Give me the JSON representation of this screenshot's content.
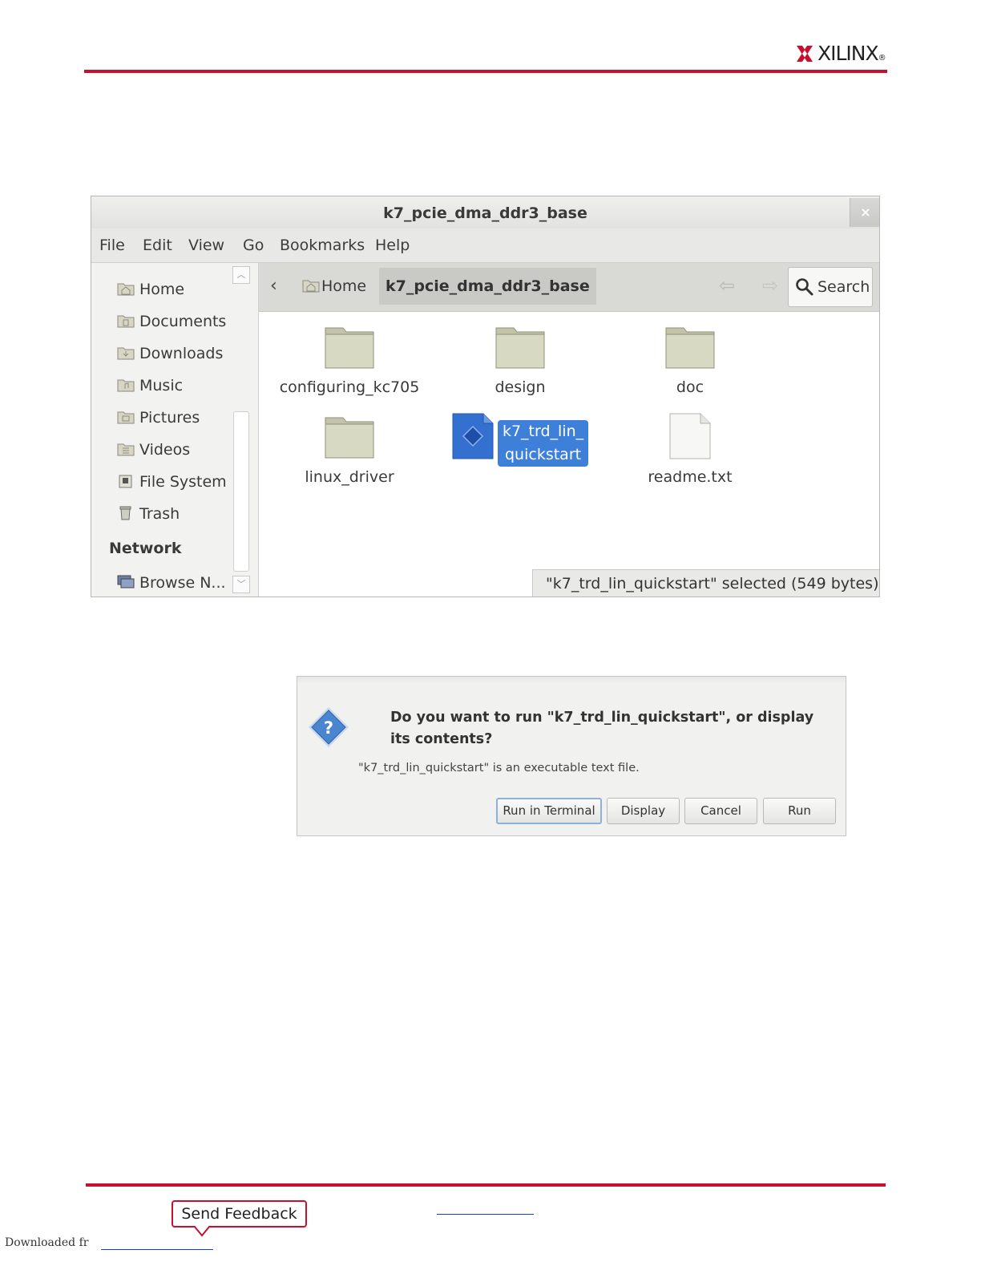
{
  "brand": {
    "name": "XILINX",
    "registered": "®",
    "accent_color": "#c8102e"
  },
  "file_manager": {
    "title": "k7_pcie_dma_ddr3_base",
    "close_glyph": "×",
    "menu": [
      "File",
      "Edit",
      "View",
      "Go",
      "Bookmarks",
      "Help"
    ],
    "sidebar": {
      "places": [
        {
          "label": "Home",
          "icon": "home-folder-icon"
        },
        {
          "label": "Documents",
          "icon": "documents-folder-icon"
        },
        {
          "label": "Downloads",
          "icon": "downloads-folder-icon"
        },
        {
          "label": "Music",
          "icon": "music-folder-icon"
        },
        {
          "label": "Pictures",
          "icon": "pictures-folder-icon"
        },
        {
          "label": "Videos",
          "icon": "videos-folder-icon"
        },
        {
          "label": "File System",
          "icon": "drive-icon"
        },
        {
          "label": "Trash",
          "icon": "trash-icon"
        }
      ],
      "network_heading": "Network",
      "network_items": [
        {
          "label": "Browse N...",
          "icon": "network-computer-icon"
        }
      ]
    },
    "toolbar": {
      "back_glyph": "‹",
      "home_crumb": "Home",
      "current_crumb": "k7_pcie_dma_ddr3_base",
      "search_label": "Search"
    },
    "files": [
      {
        "name": "configuring_kc705",
        "kind": "folder"
      },
      {
        "name": "design",
        "kind": "folder"
      },
      {
        "name": "doc",
        "kind": "folder"
      },
      {
        "name": "linux_driver",
        "kind": "folder"
      },
      {
        "name_line1": "k7_trd_lin_",
        "name_line2": "quickstart",
        "kind": "executable",
        "selected": true
      },
      {
        "name": "readme.txt",
        "kind": "text"
      }
    ],
    "status": "\"k7_trd_lin_quickstart\" selected (549 bytes)",
    "selection_color": "#3d7fd9"
  },
  "dialog": {
    "question": "Do you want to run \"k7_trd_lin_quickstart\", or display its contents?",
    "detail": "\"k7_trd_lin_quickstart\" is an executable text file.",
    "buttons": {
      "run_in_terminal": "Run in Terminal",
      "display": "Display",
      "cancel": "Cancel",
      "run": "Run"
    }
  },
  "footer": {
    "feedback_label": "Send Feedback",
    "downloaded_text": "Downloaded fr"
  }
}
